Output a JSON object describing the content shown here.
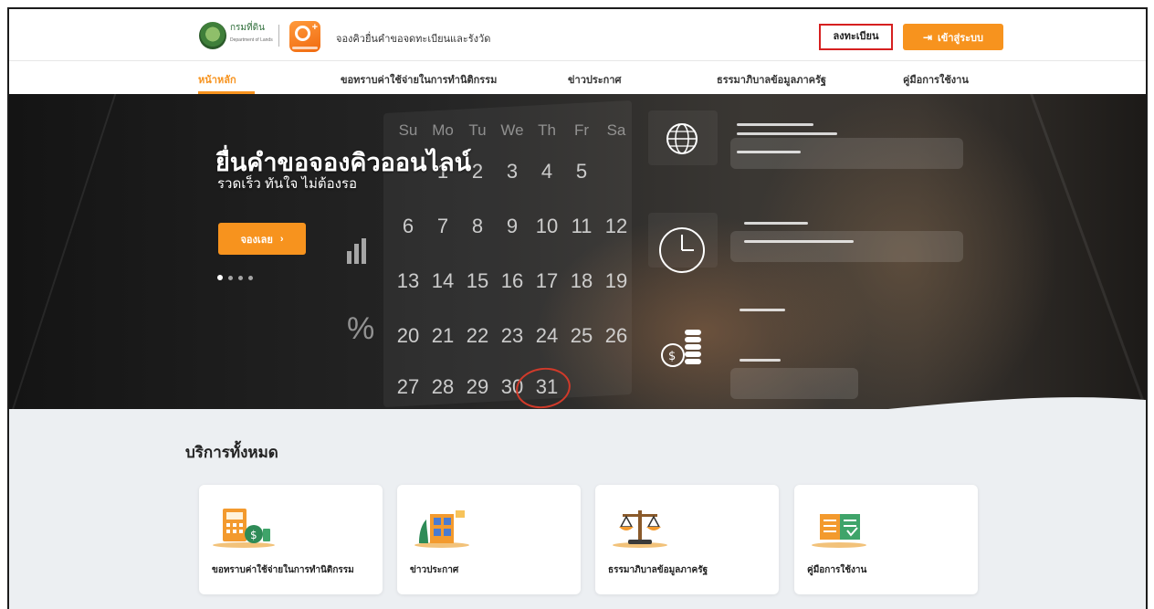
{
  "header": {
    "agency_name": "กรมที่ดิน",
    "agency_sub": "Department of Lands",
    "site_title": "จองคิวยื่นคำขอจดทะเบียนและรังวัด",
    "register_label": "ลงทะเบียน",
    "login_label": "เข้าสู่ระบบ"
  },
  "nav": {
    "items": [
      {
        "label": "หน้าหลัก",
        "active": true
      },
      {
        "label": "ขอทราบค่าใช้จ่ายในการทำนิติกรรม"
      },
      {
        "label": "ข่าวประกาศ"
      },
      {
        "label": "ธรรมาภิบาลข้อมูลภาครัฐ"
      },
      {
        "label": "คู่มือการใช้งาน"
      }
    ]
  },
  "hero": {
    "title": "ยื่นคำขอจองคิวออนไลน์",
    "subtitle": "รวดเร็ว ทันใจ ไม่ต้องรอ",
    "button_label": "จองเลย",
    "slide_count": 4,
    "active_slide": 1,
    "calendar": {
      "weekdays": [
        "Su",
        "Mo",
        "Tu",
        "We",
        "Th",
        "Fr",
        "Sa"
      ],
      "rows": [
        [
          "",
          "",
          "",
          "1",
          "2",
          "3",
          "4",
          "5"
        ],
        [
          "6",
          "7",
          "8",
          "9",
          "10",
          "11",
          "12"
        ],
        [
          "13",
          "14",
          "15",
          "16",
          "17",
          "18",
          "19"
        ],
        [
          "20",
          "21",
          "22",
          "23",
          "24",
          "25",
          "26"
        ],
        [
          "27",
          "28",
          "29",
          "30",
          "31"
        ]
      ]
    }
  },
  "services": {
    "title": "บริการทั้งหมด",
    "cards": [
      {
        "label": "ขอทราบค่าใช้จ่ายในการทำนิติกรรม",
        "icon": "calculator-money-icon"
      },
      {
        "label": "ข่าวประกาศ",
        "icon": "news-building-icon"
      },
      {
        "label": "ธรรมาภิบาลข้อมูลภาครัฐ",
        "icon": "scales-icon"
      },
      {
        "label": "คู่มือการใช้งาน",
        "icon": "manual-book-icon"
      }
    ]
  },
  "colors": {
    "accent": "#f7931e",
    "highlight_border": "#d62020"
  }
}
